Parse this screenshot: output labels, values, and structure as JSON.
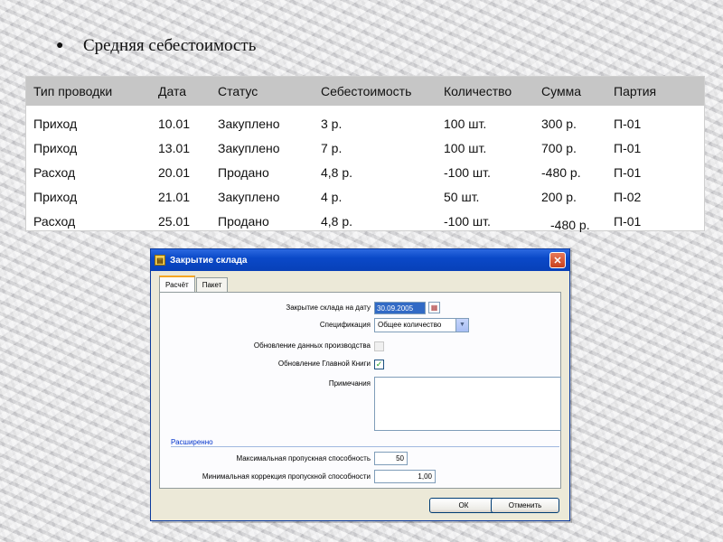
{
  "slide": {
    "title": "Средняя себестоимость"
  },
  "table": {
    "headers": [
      "Тип проводки",
      "Дата",
      "Статус",
      "Себестоимость",
      "Количество",
      "Сумма",
      "Партия"
    ],
    "rows": [
      [
        "Приход",
        "10.01",
        "Закуплено",
        "3 р.",
        "100 шт.",
        "300 р.",
        "П-01"
      ],
      [
        "Приход",
        "13.01",
        "Закуплено",
        "7 р.",
        "100 шт.",
        "700 р.",
        "П-01"
      ],
      [
        "Расход",
        "20.01",
        "Продано",
        "4,8 р.",
        "-100 шт.",
        "-480 р.",
        "П-01"
      ],
      [
        "Приход",
        "21.01",
        "Закуплено",
        "4 р.",
        "50 шт.",
        "200 р.",
        "П-02"
      ],
      [
        "Расход",
        "25.01",
        "Продано",
        "4,8 р.",
        "-100 шт.",
        "-480 р.",
        "П-01"
      ]
    ]
  },
  "dialog": {
    "title": "Закрытие склада",
    "close_glyph": "✕",
    "tabs": [
      "Расчёт",
      "Пакет"
    ],
    "fields": {
      "close_date_label": "Закрытие склада на дату",
      "close_date_value": "30.09.2005",
      "spec_label": "Спецификация",
      "spec_value": "Общее количество",
      "update_label": "Обновление данных производства",
      "ledger_label": "Обновление Главной Книги",
      "ledger_check": "✓",
      "notes_label": "Примечания",
      "advanced_link": "Расширенно",
      "max_capacity_label": "Максимальная пропускная способность",
      "max_capacity_value": "50",
      "min_capacity_label": "Минимальная коррекция пропускной способности",
      "min_capacity_value": "1,00"
    },
    "buttons": {
      "ok": "ОК",
      "cancel": "Отменить"
    }
  }
}
